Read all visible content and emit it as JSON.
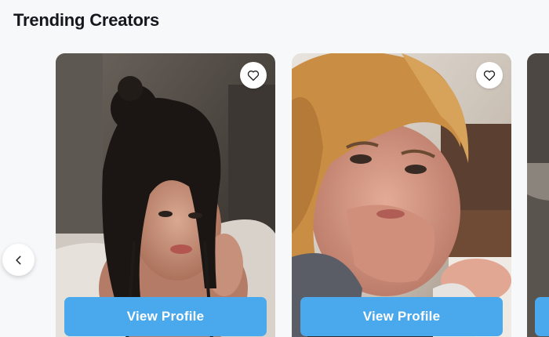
{
  "section": {
    "title": "Trending Creators"
  },
  "carousel": {
    "prev_icon": "chevron-left-icon",
    "cards": [
      {
        "button_label": "View Profile",
        "favorite_icon": "heart-outline-icon"
      },
      {
        "button_label": "View Profile",
        "favorite_icon": "heart-outline-icon"
      },
      {
        "button_label": ""
      }
    ]
  },
  "colors": {
    "accent": "#4aa8ec",
    "background": "#f7f8fa",
    "title": "#16161d"
  }
}
